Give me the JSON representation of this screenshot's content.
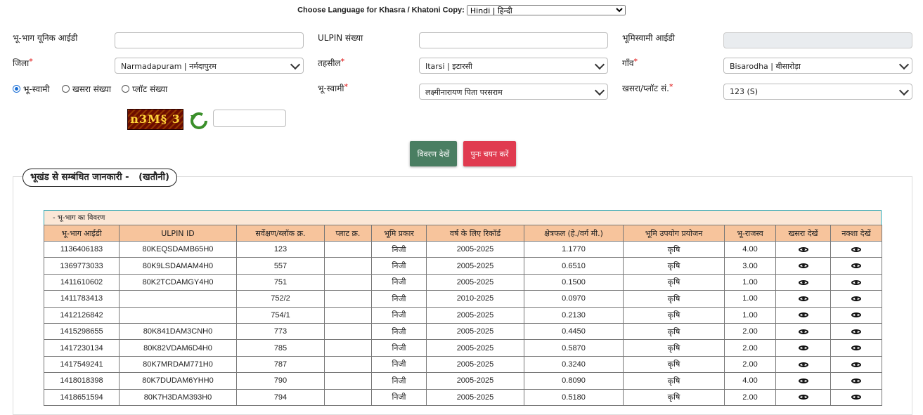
{
  "language_bar": {
    "label": "Choose Language for Khasra / Khatoni Copy:",
    "selected": "Hindi | हिन्दी"
  },
  "form": {
    "unique_id_label": "भू-भाग यूनिक आईडी",
    "ulpin_label": "ULPIN संख्या",
    "owner_id_label": "भूमिस्वामी आईडी",
    "district_label": "जिला",
    "district_value": "Narmadapuram | नर्मदापुरम",
    "tehsil_label": "तहसील",
    "tehsil_value": "Itarsi | इटारसी",
    "village_label": "गाँव",
    "village_value": "Bisarodha | बीसारोड़ा",
    "radio_owner": "भू-स्वामी",
    "radio_khasra": "खसरा संख्या",
    "radio_plot": "प्लॉट संख्या",
    "owner_label": "भू-स्वामी",
    "owner_value": "लक्ष्मीनारायण पिता परसराम",
    "khasra_label": "खसरा/प्लॉट सं.",
    "khasra_value": "123 (S)",
    "required_mark": "*",
    "captcha_text": "n3M§ 3"
  },
  "buttons": {
    "view": "विवरण देखें",
    "reset": "पुनः चयन करें"
  },
  "section": {
    "legend": "भूखंड से सम्बंधित जानकारी -   (खतौनी)",
    "table_title": "- भू-भाग का विवरण"
  },
  "table": {
    "headers": [
      "भू-भाग आईडी",
      "ULPIN ID",
      "सर्वेक्षण/ब्लॉक क्र.",
      "प्लाट क्र.",
      "भूमि प्रकार",
      "वर्ष के लिए रिकॉर्ड",
      "क्षेत्रफल (हे./वर्ग मी.)",
      "भूमि उपयोग प्रयोजन",
      "भू-राजस्व",
      "खसरा देखें",
      "नक्शा देखें"
    ],
    "rows": [
      [
        "1136406183",
        "80KEQSDAMB65H0",
        "123",
        "",
        "निजी",
        "2005-2025",
        "1.1770",
        "कृषि",
        "4.00"
      ],
      [
        "1369773033",
        "80K9LSDAMAM4H0",
        "557",
        "",
        "निजी",
        "2005-2025",
        "0.6510",
        "कृषि",
        "3.00"
      ],
      [
        "1411610602",
        "80K2TCDAMGY4H0",
        "751",
        "",
        "निजी",
        "2005-2025",
        "0.1500",
        "कृषि",
        "1.00"
      ],
      [
        "1411783413",
        "",
        "752/2",
        "",
        "निजी",
        "2010-2025",
        "0.0970",
        "कृषि",
        "1.00"
      ],
      [
        "1412126842",
        "",
        "754/1",
        "",
        "निजी",
        "2005-2025",
        "0.2130",
        "कृषि",
        "1.00"
      ],
      [
        "1415298655",
        "80K841DAM3CNH0",
        "773",
        "",
        "निजी",
        "2005-2025",
        "0.4450",
        "कृषि",
        "2.00"
      ],
      [
        "1417230134",
        "80K82VDAM6D4H0",
        "785",
        "",
        "निजी",
        "2005-2025",
        "0.5870",
        "कृषि",
        "2.00"
      ],
      [
        "1417549241",
        "80K7MRDAM771H0",
        "787",
        "",
        "निजी",
        "2005-2025",
        "0.3240",
        "कृषि",
        "2.00"
      ],
      [
        "1418018398",
        "80K7DUDAM6YHH0",
        "790",
        "",
        "निजी",
        "2005-2025",
        "0.8090",
        "कृषि",
        "4.00"
      ],
      [
        "1418651594",
        "80K7H3DAM393H0",
        "794",
        "",
        "निजी",
        "2005-2025",
        "0.5180",
        "कृषि",
        "2.00"
      ]
    ]
  },
  "colors": {
    "header_bg": "#f7c49c",
    "title_bg": "#fbe7d6",
    "view_btn": "#4a7e62",
    "reset_btn": "#e03b50"
  }
}
